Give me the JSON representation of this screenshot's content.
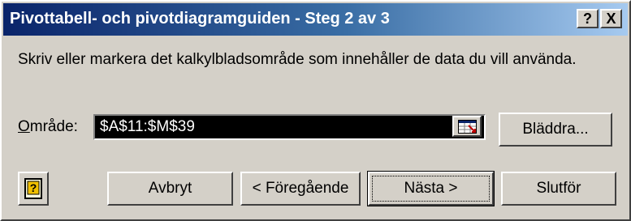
{
  "window": {
    "title": "Pivottabell- och pivotdiagramguiden - Steg 2 av 3",
    "help_button_label": "?",
    "close_button_label": "X"
  },
  "instruction": "Skriv eller markera det kalkylbladsområde som innehåller de data du vill använda.",
  "range": {
    "label_prefix": "O",
    "label_rest": "mråde:",
    "value": "$A$11:$M$39"
  },
  "buttons": {
    "browse": "Bläddra...",
    "cancel": "Avbryt",
    "previous": "< Föregående",
    "next": "Nästa >",
    "finish": "Slutför"
  }
}
